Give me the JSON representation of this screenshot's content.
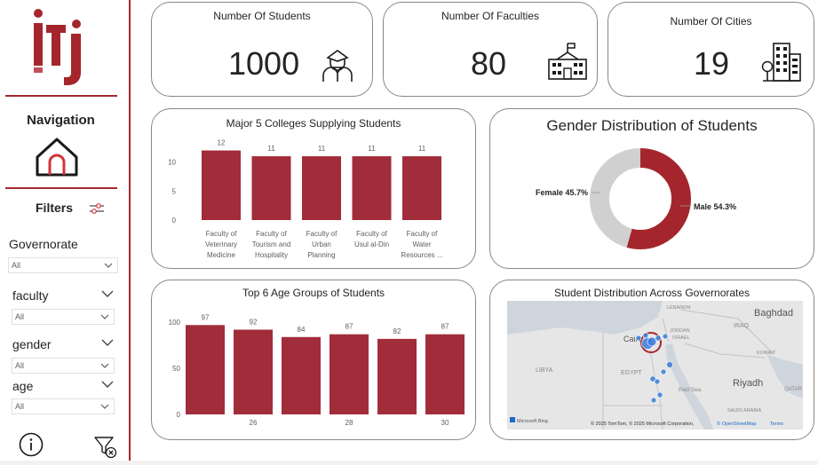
{
  "sidebar": {
    "nav_title": "Navigation",
    "filters_title": "Filters",
    "slicers": [
      {
        "label": "Governorate",
        "value": "All"
      },
      {
        "label": "faculty",
        "value": "All"
      },
      {
        "label": "gender",
        "value": "All"
      },
      {
        "label": "age",
        "value": "All"
      }
    ]
  },
  "kpis": [
    {
      "label": "Number Of Students",
      "value": "1000",
      "icon": "student-icon"
    },
    {
      "label": "Number Of Faculties",
      "value": "80",
      "icon": "school-icon"
    },
    {
      "label": "Number Of Cities",
      "value": "19",
      "icon": "city-icon"
    }
  ],
  "colors": {
    "accent": "#a4262c",
    "bar": "#a12d3a",
    "donut_grey": "#d0d0d0",
    "map_point": "#3b7dd8"
  },
  "colleges_chart": {
    "title": "Major 5 Colleges Supplying Students",
    "ticks": [
      "0",
      "5",
      "10"
    ],
    "labels": [
      [
        "Faculty of",
        "Veterinary",
        "Medicine"
      ],
      [
        "Faculty of",
        "Tourism and",
        "Hospitality"
      ],
      [
        "Faculty of",
        "Urban",
        "Planning"
      ],
      [
        "Faculty of",
        "Usul al-Din"
      ],
      [
        "Faculty of",
        "Water",
        "Resources ..."
      ]
    ]
  },
  "gender_chart": {
    "title": "Gender Distribution of Students",
    "female_label": "Female 45.7%",
    "male_label": "Male 54.3%"
  },
  "age_chart": {
    "title": "Top 6 Age Groups of Students",
    "ticks": [
      "0",
      "50",
      "100"
    ]
  },
  "map": {
    "title": "Student Distribution Across Governorates",
    "places": {
      "lebanon": "LEBANON",
      "iraq": "IRAQ",
      "baghdad": "Baghdad",
      "israel": "ISRAEL",
      "jordan": "JORDAN",
      "kuwait": "KUWAIT",
      "libya": "LIBYA",
      "egypt": "EGYPT",
      "red_sea": "Red Sea",
      "riyadh": "Riyadh",
      "saudi": "SAUDI ARABIA",
      "qatar": "QATAR",
      "cairo": "Cairo"
    },
    "bing": "Microsoft Bing",
    "attribution": "© 2025 TomTom, © 2025 Microsoft Corporation,",
    "osm": "© OpenStreetMap",
    "terms": "Terms"
  },
  "chart_data": [
    {
      "type": "bar",
      "title": "Major 5 Colleges Supplying Students",
      "categories": [
        "Faculty of Veterinary Medicine",
        "Faculty of Tourism and Hospitality",
        "Faculty of Urban Planning",
        "Faculty of Usul al-Din",
        "Faculty of Water Resources ..."
      ],
      "values": [
        12,
        11,
        11,
        11,
        11
      ],
      "ylim": [
        0,
        13
      ],
      "yticks": [
        0,
        5,
        10
      ]
    },
    {
      "type": "pie",
      "title": "Gender Distribution of Students",
      "categories": [
        "Female",
        "Male"
      ],
      "values": [
        45.7,
        54.3
      ]
    },
    {
      "type": "bar",
      "title": "Top 6 Age Groups of Students",
      "categories": [
        "",
        "26",
        "",
        "28",
        "",
        "30"
      ],
      "values": [
        97,
        92,
        84,
        87,
        82,
        87
      ],
      "ylim": [
        0,
        105
      ],
      "yticks": [
        0,
        50,
        100
      ]
    }
  ]
}
